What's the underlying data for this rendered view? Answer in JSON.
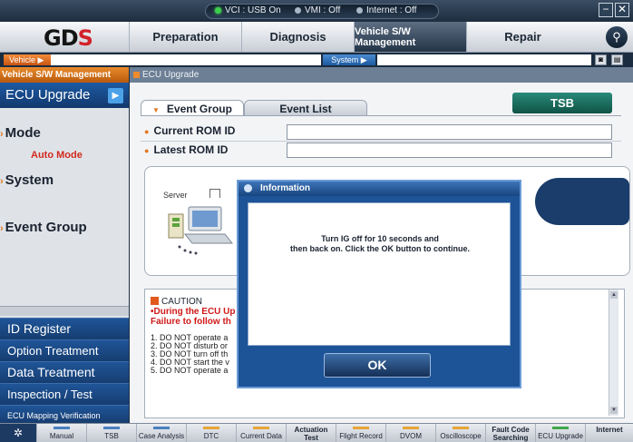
{
  "status": {
    "vci": "VCI : USB On",
    "vmi": "VMI : Off",
    "internet": "Internet : Off",
    "colors": {
      "vci": "#3bd04a",
      "vmi": "#a9b7c6",
      "internet": "#a9b7c6"
    }
  },
  "window": {
    "minimize": "−",
    "close": "✕"
  },
  "logo": {
    "text_left": "GD",
    "text_right": "S"
  },
  "nav": {
    "tabs": [
      {
        "label": "Preparation"
      },
      {
        "label": "Diagnosis"
      },
      {
        "label": "Vehicle S/W Management"
      },
      {
        "label": "Repair"
      }
    ],
    "search_icon": "search-icon"
  },
  "crumbs": {
    "vehicle": "Vehicle ▶",
    "system": "System ▶"
  },
  "left": {
    "header": "Vehicle S/W Management",
    "current": "ECU Upgrade",
    "menu": {
      "mode": "Mode",
      "auto_mode": "Auto Mode",
      "system": "System",
      "event_group": "Event Group"
    },
    "buttons": [
      {
        "label": "ID Register"
      },
      {
        "label": "Option Treatment"
      },
      {
        "label": "Data Treatment"
      },
      {
        "label": "Inspection / Test"
      },
      {
        "label": "ECU Mapping Verification"
      }
    ]
  },
  "content": {
    "header": "ECU Upgrade",
    "tabs": {
      "event_group": "Event Group",
      "event_list": "Event List"
    },
    "tsb": "TSB",
    "current_rom_label": "Current ROM ID",
    "current_rom_value": "",
    "latest_rom_label": "Latest ROM ID",
    "latest_rom_value": "",
    "server_label": "Server",
    "caution": {
      "title": "CAUTION",
      "line1": "•During the ECU Up",
      "line2": "Failure to follow th",
      "items": [
        "1. DO NOT operate a",
        "2. DO NOT disturb or",
        "3. DO NOT turn off th",
        "4. DO NOT start the v",
        "5. DO NOT operate a"
      ]
    }
  },
  "dialog": {
    "title": "Information",
    "message_line1": "Turn IG off for 10 seconds and",
    "message_line2": "then back on. Click the OK button to continue.",
    "ok": "OK"
  },
  "bottom": {
    "home_icon": "wrench-icon",
    "buttons": [
      {
        "label": "Manual",
        "bar": "blue"
      },
      {
        "label": "TSB",
        "bar": "blue"
      },
      {
        "label": "Case Analysis",
        "bar": "blue"
      },
      {
        "label": "DTC",
        "bar": "yellow"
      },
      {
        "label": "Current Data",
        "bar": "yellow"
      },
      {
        "label": "Actuation Test",
        "bar": "yellow"
      },
      {
        "label": "Flight Record",
        "bar": "yellow"
      },
      {
        "label": "DVOM",
        "bar": "yellow"
      },
      {
        "label": "Oscilloscope",
        "bar": "yellow"
      },
      {
        "label": "Fault Code Searching",
        "bar": "yellow"
      },
      {
        "label": "ECU Upgrade",
        "bar": "green"
      },
      {
        "label": "Internet",
        "bar": "blue"
      }
    ]
  }
}
